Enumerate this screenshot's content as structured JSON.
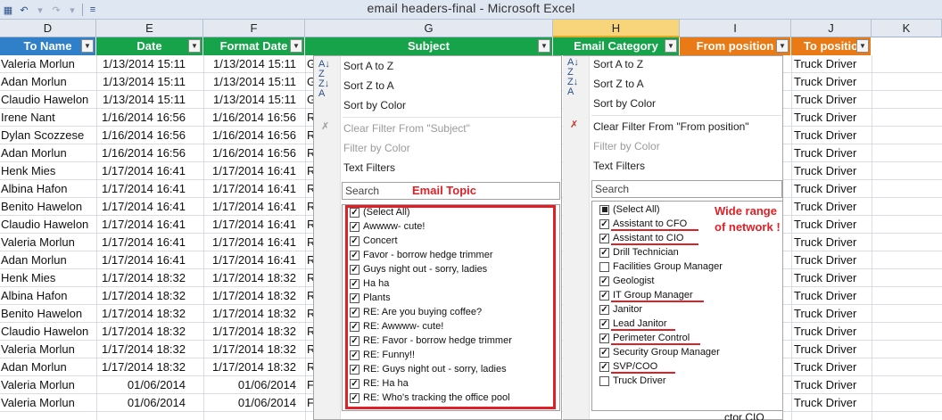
{
  "window": {
    "title": "email headers-final  -  Microsoft Excel"
  },
  "qat": {
    "save_icon": "save-icon",
    "undo_icon": "undo-icon",
    "redo_icon": "redo-icon",
    "customize_icon": "customize-icon"
  },
  "columns": [
    "D",
    "E",
    "F",
    "G",
    "H",
    "I",
    "J",
    "K"
  ],
  "headers": {
    "to_name": "To Name",
    "date": "Date",
    "format_date": "Format Date",
    "subject": "Subject",
    "email_category": "Email Category",
    "from_position": "From position",
    "to_position": "To positio"
  },
  "rows": [
    {
      "name": "Valeria Morlun",
      "date": "1/13/2014 15:11",
      "fdate": "1/13/2014 15:11",
      "subj": "G",
      "pos": "Truck Driver"
    },
    {
      "name": "Adan Morlun",
      "date": "1/13/2014 15:11",
      "fdate": "1/13/2014 15:11",
      "subj": "G",
      "pos": "Truck Driver"
    },
    {
      "name": "Claudio Hawelon",
      "date": "1/13/2014 15:11",
      "fdate": "1/13/2014 15:11",
      "subj": "G",
      "pos": "Truck Driver"
    },
    {
      "name": "Irene Nant",
      "date": "1/16/2014 16:56",
      "fdate": "1/16/2014 16:56",
      "subj": "R",
      "pos": "Truck Driver"
    },
    {
      "name": "Dylan Scozzese",
      "date": "1/16/2014 16:56",
      "fdate": "1/16/2014 16:56",
      "subj": "R",
      "pos": "Truck Driver"
    },
    {
      "name": "Adan Morlun",
      "date": "1/16/2014 16:56",
      "fdate": "1/16/2014 16:56",
      "subj": "R",
      "pos": "Truck Driver"
    },
    {
      "name": "Henk Mies",
      "date": "1/17/2014 16:41",
      "fdate": "1/17/2014 16:41",
      "subj": "R",
      "pos": "Truck Driver"
    },
    {
      "name": "Albina Hafon",
      "date": "1/17/2014 16:41",
      "fdate": "1/17/2014 16:41",
      "subj": "R",
      "pos": "Truck Driver"
    },
    {
      "name": "Benito Hawelon",
      "date": "1/17/2014 16:41",
      "fdate": "1/17/2014 16:41",
      "subj": "R",
      "pos": "Truck Driver"
    },
    {
      "name": "Claudio Hawelon",
      "date": "1/17/2014 16:41",
      "fdate": "1/17/2014 16:41",
      "subj": "R",
      "pos": "Truck Driver"
    },
    {
      "name": "Valeria Morlun",
      "date": "1/17/2014 16:41",
      "fdate": "1/17/2014 16:41",
      "subj": "R",
      "pos": "Truck Driver"
    },
    {
      "name": "Adan Morlun",
      "date": "1/17/2014 16:41",
      "fdate": "1/17/2014 16:41",
      "subj": "R",
      "pos": "Truck Driver"
    },
    {
      "name": "Henk Mies",
      "date": "1/17/2014 18:32",
      "fdate": "1/17/2014 18:32",
      "subj": "R",
      "pos": "Truck Driver"
    },
    {
      "name": "Albina Hafon",
      "date": "1/17/2014 18:32",
      "fdate": "1/17/2014 18:32",
      "subj": "R",
      "pos": "Truck Driver"
    },
    {
      "name": "Benito Hawelon",
      "date": "1/17/2014 18:32",
      "fdate": "1/17/2014 18:32",
      "subj": "R",
      "pos": "Truck Driver"
    },
    {
      "name": "Claudio Hawelon",
      "date": "1/17/2014 18:32",
      "fdate": "1/17/2014 18:32",
      "subj": "R",
      "pos": "Truck Driver"
    },
    {
      "name": "Valeria Morlun",
      "date": "1/17/2014 18:32",
      "fdate": "1/17/2014 18:32",
      "subj": "R",
      "pos": "Truck Driver"
    },
    {
      "name": "Adan Morlun",
      "date": "1/17/2014 18:32",
      "fdate": "1/17/2014 18:32",
      "subj": "R",
      "pos": "Truck Driver"
    },
    {
      "name": "Valeria Morlun",
      "date": "01/06/2014",
      "fdate": "01/06/2014",
      "subj": "F",
      "pos": "Truck Driver"
    },
    {
      "name": "Valeria Morlun",
      "date": "01/06/2014",
      "fdate": "01/06/2014",
      "subj": "F",
      "pos": "Truck Driver"
    }
  ],
  "subject_filter": {
    "sort_az": "Sort A to Z",
    "sort_za": "Sort Z to A",
    "sort_color": "Sort by Color",
    "clear_filter": "Clear Filter From \"Subject\"",
    "filter_color": "Filter by Color",
    "text_filters": "Text Filters",
    "search_placeholder": "Search",
    "annotation": "Email Topic",
    "items": [
      "(Select All)",
      "Awwww- cute!",
      "Concert",
      "Favor - borrow hedge trimmer",
      "Guys night out - sorry, ladies",
      "Ha ha",
      "Plants",
      "RE: Are you buying coffee?",
      "RE: Awwww- cute!",
      "RE: Favor - borrow hedge trimmer",
      "RE: Funny!!",
      "RE: Guys night out - sorry, ladies",
      "RE: Ha ha",
      "RE: Who's tracking the office pool"
    ]
  },
  "position_filter": {
    "sort_az": "Sort A to Z",
    "sort_za": "Sort Z to A",
    "sort_color": "Sort by Color",
    "clear_filter": "Clear Filter From \"From position\"",
    "filter_color": "Filter by Color",
    "text_filters": "Text Filters",
    "search_placeholder": "Search",
    "annotation_line1": "Wide range",
    "annotation_line2": "of network !",
    "items": [
      "(Select All)",
      "Assistant to CFO",
      "Assistant to CIO",
      "Drill Technician",
      "Facilities Group Manager",
      "Geologist",
      "IT Group Manager",
      "Janitor",
      "Lead Janitor",
      "Perimeter Control",
      "Security Group Manager",
      "SVP/COO",
      "Truck Driver"
    ],
    "checked": [
      false,
      true,
      true,
      true,
      false,
      true,
      true,
      true,
      true,
      true,
      true,
      true,
      false
    ]
  },
  "bottom_partial": {
    "col_i": "ctor CIO"
  },
  "accent_colors": {
    "blue": "#2f7fc9",
    "green": "#16a34a",
    "orange": "#ea7a15",
    "annotation_red": "#e01f26"
  }
}
